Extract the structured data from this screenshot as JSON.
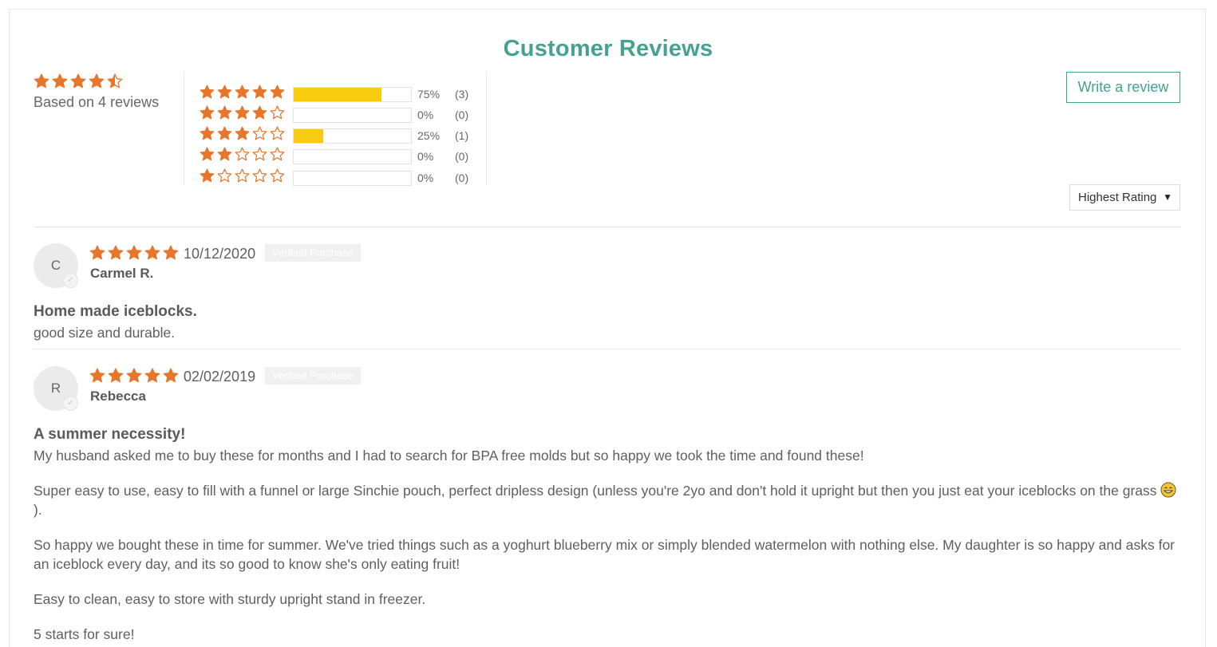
{
  "title": "Customer Reviews",
  "summary": {
    "rating": 4.5,
    "based_on": "Based on 4 reviews"
  },
  "histogram": [
    {
      "stars": 5,
      "fraction": 0.75,
      "percent": "75%",
      "count": "(3)"
    },
    {
      "stars": 4,
      "fraction": 0.0,
      "percent": "0%",
      "count": "(0)"
    },
    {
      "stars": 3,
      "fraction": 0.25,
      "percent": "25%",
      "count": "(1)"
    },
    {
      "stars": 2,
      "fraction": 0.0,
      "percent": "0%",
      "count": "(0)"
    },
    {
      "stars": 1,
      "fraction": 0.0,
      "percent": "0%",
      "count": "(0)"
    }
  ],
  "actions": {
    "write_review": "Write a review",
    "sort_selected": "Highest Rating"
  },
  "colors": {
    "accent": "#45a28e",
    "star": "#e8762a",
    "bar_fill": "#f8cb10"
  },
  "icons": {
    "star": "star-icon",
    "check": "check-icon",
    "caret": "caret-down-icon",
    "emoji": "grinning-face-icon"
  },
  "reviews": [
    {
      "initial": "C",
      "rating": 5,
      "date": "10/12/2020",
      "badge": "Verified Purchase",
      "name": "Carmel R.",
      "title": "Home made iceblocks.",
      "body": [
        "good size and durable."
      ]
    },
    {
      "initial": "R",
      "rating": 5,
      "date": "02/02/2019",
      "badge": "Verified Purchase",
      "name": "Rebecca",
      "title": "A summer necessity!",
      "body": [
        "My husband asked me to buy these for months and I had to search for BPA free molds but so happy we took the time and found these!",
        "Super easy to use, easy to fill with a funnel or large Sinchie pouch, perfect dripless design (unless you're 2yo and don't hold it upright but then you just eat your iceblocks on the grass",
        "So happy we bought these in time for summer. We've tried things such as a yoghurt blueberry mix or simply blended watermelon with nothing else. My daughter is so happy and asks for an iceblock every day, and its so good to know she's only eating fruit!",
        "Easy to clean, easy to store with sturdy upright stand in freezer.",
        "5 starts for sure!"
      ],
      "body_tail": ")."
    }
  ]
}
